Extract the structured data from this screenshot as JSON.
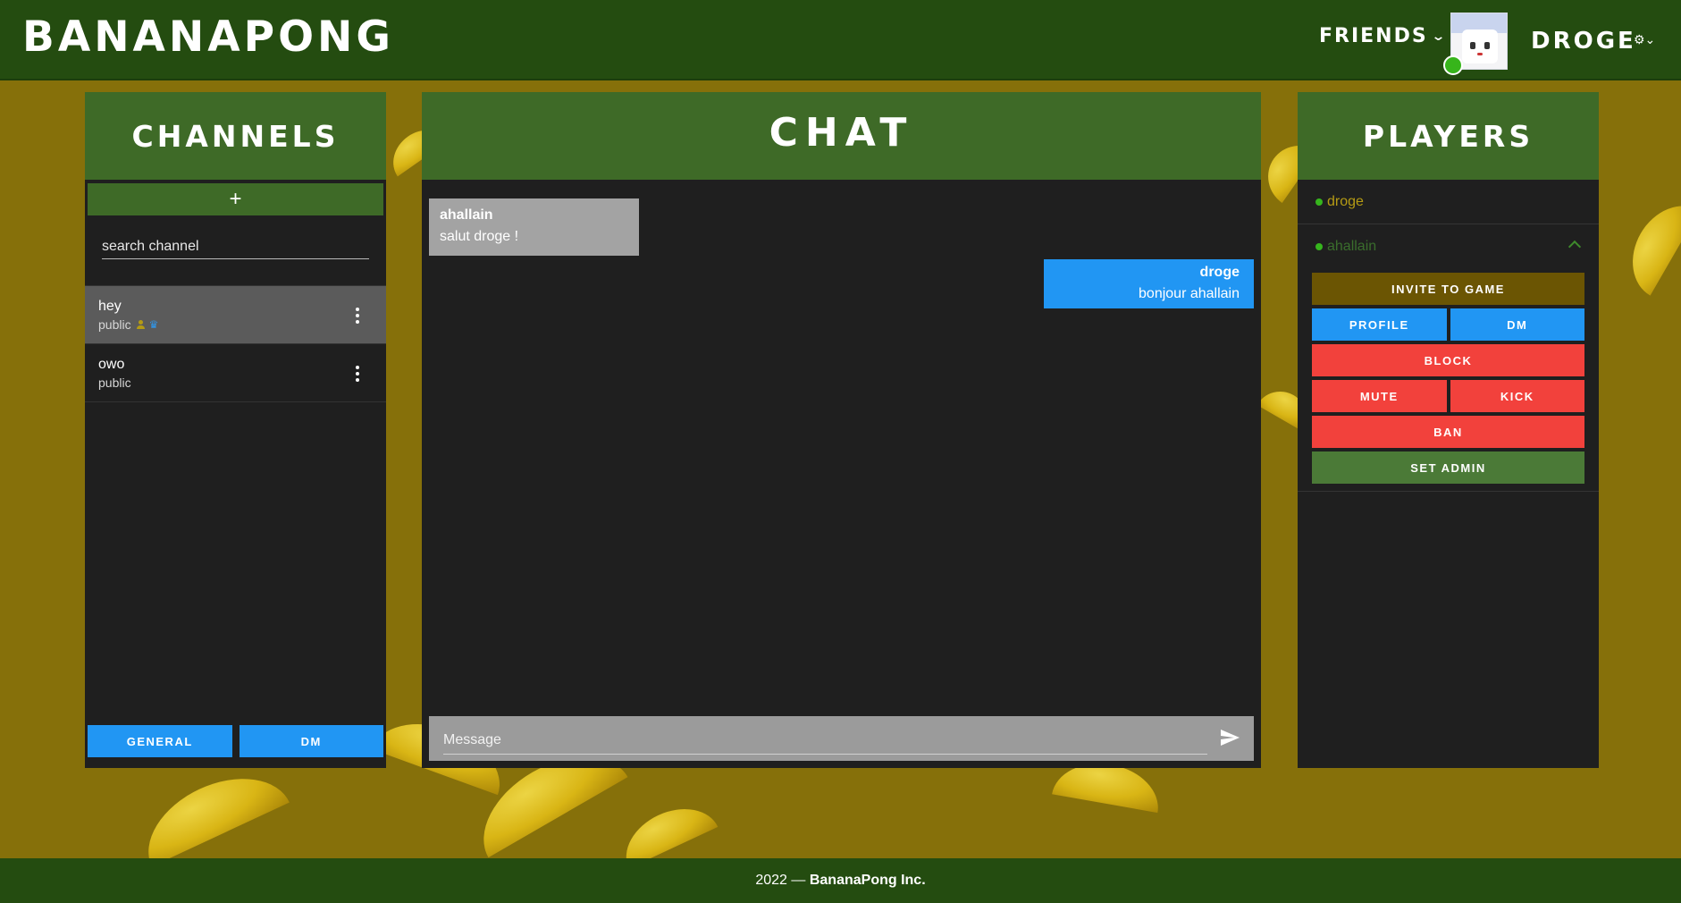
{
  "header": {
    "brand": "BANANAPONG",
    "friends_label": "FRIENDS",
    "username": "DROGE"
  },
  "channels": {
    "title": "CHANNELS",
    "add_label": "+",
    "search_placeholder": "search channel",
    "items": [
      {
        "name": "hey",
        "visibility": "public"
      },
      {
        "name": "owo",
        "visibility": "public"
      }
    ],
    "tabs": {
      "general": "GENERAL",
      "dm": "DM"
    }
  },
  "chat": {
    "title": "CHAT",
    "messages": [
      {
        "author": "ahallain",
        "text": "salut droge !"
      },
      {
        "author": "droge",
        "text": "bonjour ahallain"
      }
    ],
    "composer_placeholder": "Message"
  },
  "players": {
    "title": "PLAYERS",
    "list": [
      {
        "name": "droge"
      },
      {
        "name": "ahallain"
      }
    ],
    "actions": {
      "invite": "INVITE TO GAME",
      "profile": "PROFILE",
      "dm": "DM",
      "block": "BLOCK",
      "mute": "MUTE",
      "kick": "KICK",
      "ban": "BAN",
      "set_admin": "SET ADMIN"
    }
  },
  "footer": {
    "year": "2022 —",
    "company": "BananaPong Inc."
  },
  "colors": {
    "header_green": "#244c10",
    "panel_green": "#3e6a27",
    "background_banana": "#86700a",
    "blue": "#2196f3",
    "red": "#f2413c",
    "online": "#37b51b"
  }
}
